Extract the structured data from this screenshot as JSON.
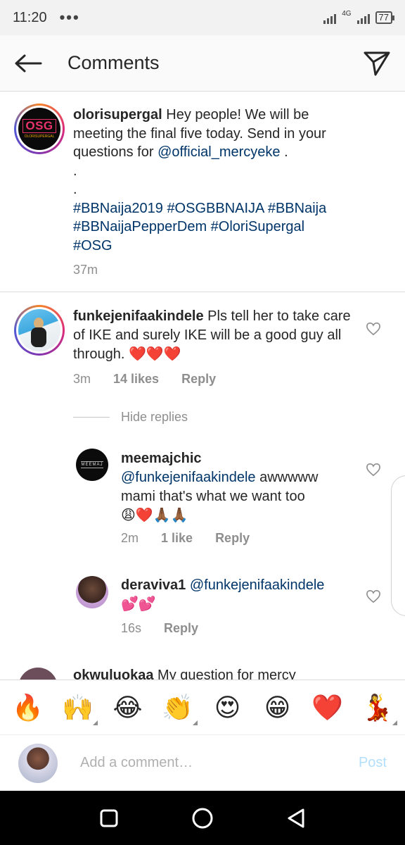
{
  "status": {
    "time": "11:20",
    "dots": "•••",
    "network": "4G",
    "battery": "77"
  },
  "header": {
    "title": "Comments"
  },
  "caption": {
    "username": "olorisupergal",
    "line1": " Hey people! We will be meeting the final five today. Send in your questions for ",
    "mention": "@official_mercyeke",
    "after_mention": " .",
    "dot1": ".",
    "dot2": ".",
    "hashtags": [
      "#BBNaija2019",
      "#OSGBBNAIJA",
      "#BBNaija",
      "#BBNaijaPepperDem",
      "#OloriSupergal",
      "#OSG"
    ],
    "time": "37m",
    "avatar_text": "OSG",
    "avatar_sub": "OLORISUPERGAL"
  },
  "comments": [
    {
      "username": "funkejenifaakindele",
      "text": " Pls tell her to take care of IKE and surely IKE will be a good guy all through. ",
      "emoji": "❤️❤️❤️",
      "time": "3m",
      "likes": "14 likes",
      "reply": "Reply"
    }
  ],
  "hide_replies": "Hide replies",
  "replies": [
    {
      "username": "meemajchic",
      "mention": "@funkejenifaakindele",
      "text": " awwwww mami that's what we want too",
      "emoji": "😩❤️🙏🏾🙏🏾",
      "time": "2m",
      "likes": "1 like",
      "reply": "Reply",
      "avatar_text": "MEEMAJ"
    },
    {
      "username": "deraviva1",
      "mention": "@funkejenifaakindele",
      "text": "",
      "emoji": "💕💕",
      "time": "16s",
      "reply": "Reply"
    }
  ],
  "partial_comment": {
    "username": "okwuluokaa",
    "text": " My question for mercy"
  },
  "emoji_bar": [
    "🔥",
    "🙌",
    "😂",
    "👏",
    "😍",
    "😁",
    "❤️",
    "💃"
  ],
  "composer": {
    "placeholder": "Add a comment…",
    "post_label": "Post"
  }
}
